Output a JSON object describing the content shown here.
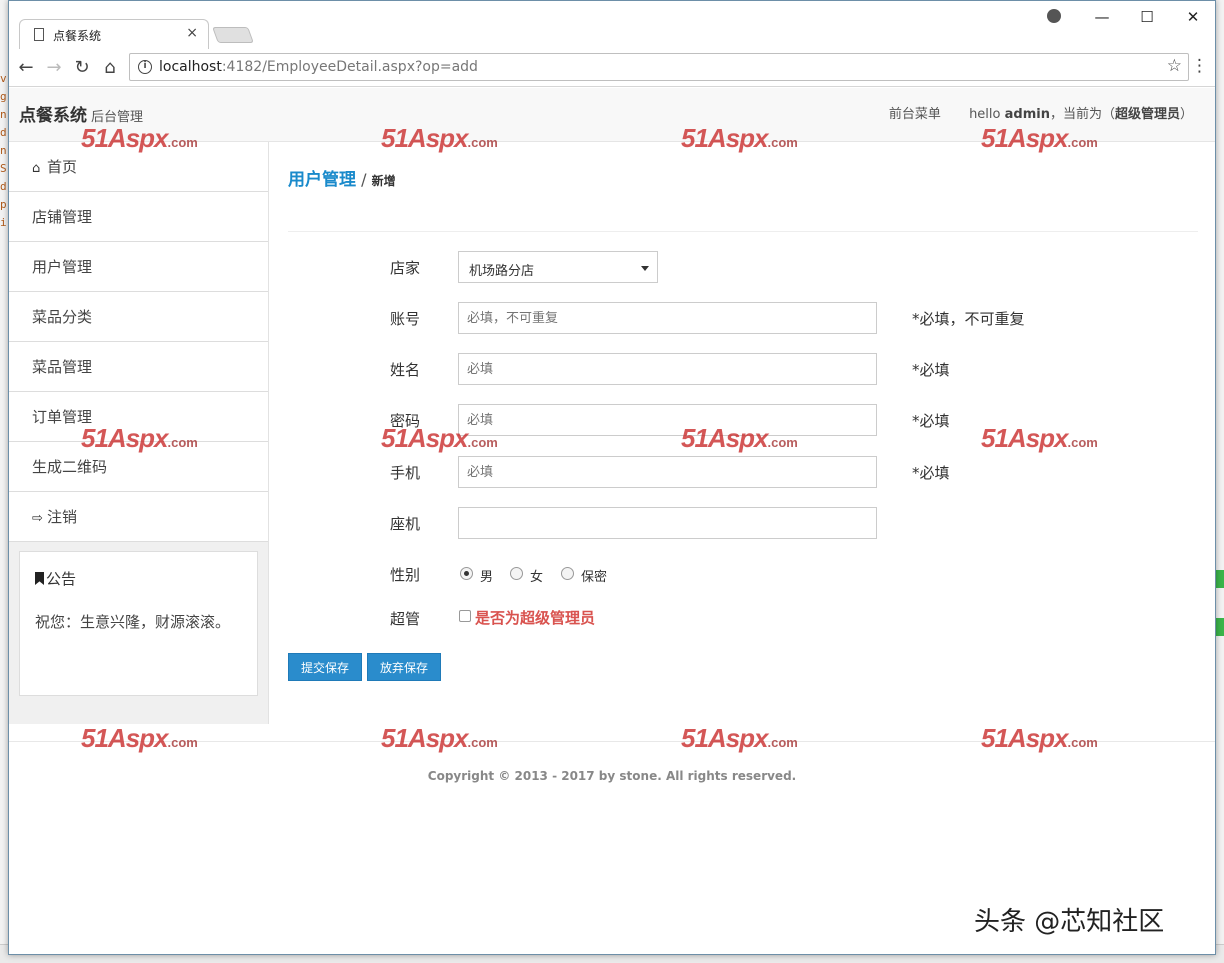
{
  "browser": {
    "tab_title": "点餐系统",
    "tab_close": "×",
    "url_host": "localhost",
    "url_rest": ":4182/EmployeeDetail.aspx?op=add",
    "info_glyph": "i",
    "back_glyph": "←",
    "forward_glyph": "→",
    "reload_glyph": "↻",
    "home_glyph": "⌂",
    "star_glyph": "☆",
    "menu_glyph": "⋮",
    "minimize_glyph": "—",
    "maximize_glyph": "☐",
    "close_glyph": "✕"
  },
  "header": {
    "brand": "点餐系统",
    "brand_sub": "后台管理",
    "front_menu": "前台菜单",
    "greeting_prefix": "hello ",
    "user": "admin",
    "role_prefix": "，当前为（",
    "role": "超级管理员",
    "role_suffix": "）"
  },
  "sidebar": {
    "items": [
      {
        "icon": "home-icon",
        "glyph": "⌂",
        "label": "首页"
      },
      {
        "label": "店铺管理"
      },
      {
        "label": "用户管理"
      },
      {
        "label": "菜品分类"
      },
      {
        "label": "菜品管理"
      },
      {
        "label": "订单管理"
      },
      {
        "label": "生成二维码"
      },
      {
        "icon": "logout-icon",
        "glyph": "⇨",
        "label": "注销"
      }
    ],
    "notice": {
      "title": "公告",
      "body": "祝您：生意兴隆，财源滚滚。"
    }
  },
  "breadcrumb": {
    "section": "用户管理",
    "separator": " / ",
    "current": "新增"
  },
  "form": {
    "store": {
      "label": "店家",
      "value": "机场路分店"
    },
    "account": {
      "label": "账号",
      "placeholder": "必填，不可重复",
      "hint": "*必填，不可重复"
    },
    "name": {
      "label": "姓名",
      "placeholder": "必填",
      "hint": "*必填"
    },
    "password": {
      "label": "密码",
      "placeholder": "必填",
      "hint": "*必填"
    },
    "mobile": {
      "label": "手机",
      "placeholder": "必填",
      "hint": "*必填"
    },
    "phone": {
      "label": "座机",
      "placeholder": ""
    },
    "gender": {
      "label": "性别",
      "options": [
        "男",
        "女",
        "保密"
      ],
      "selected": "男"
    },
    "admin": {
      "label": "超管",
      "checkbox_label": "是否为超级管理员",
      "checked": false
    },
    "submit_label": "提交保存",
    "cancel_label": "放弃保存"
  },
  "footer": {
    "copyright": "Copyright © 2013 - 2017 by stone. All rights reserved."
  },
  "watermark": {
    "main": "51Aspx",
    "suffix": ".com"
  },
  "credit": "头条 @芯知社区",
  "background_left_text": "v g n d n S d p i"
}
